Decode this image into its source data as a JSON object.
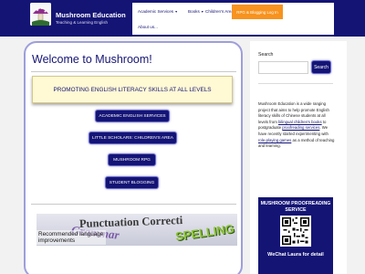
{
  "site": {
    "title": "Mushroom Education",
    "tagline": "Teaching & Learning English"
  },
  "nav": {
    "items": [
      "Academic Services",
      "Books",
      "Children's Area",
      "About us..."
    ],
    "cta": "RPG & Blogging Log In"
  },
  "main": {
    "title": "Welcome to Mushroom!",
    "banner": "PROMOTING ENGLISH LITERACY SKILLS AT ALL LEVELS",
    "buttons": [
      "ACADEMIC ENGLISH SERVICES",
      "LITTLE SCHOLARS: CHILDREN'S AREA",
      "MUSHROOM RPG",
      "STUDENT BLOGGING"
    ],
    "promo": {
      "words": [
        "Punctuation Correcti",
        "Grammar",
        "SPELLING"
      ],
      "note": "Recommended language improvements"
    }
  },
  "sidebar": {
    "search_label": "Search",
    "search_placeholder": "",
    "search_button": "Search",
    "about": {
      "intro": "Mushroom Education is a wide ranging project that aims to help promote English literacy skills of Chinese students at all levels from ",
      "link1": "bilingual children's books",
      "mid1": " to postgraduate ",
      "link2": "proofreading services",
      "mid2": ". We have recently started experimenting with ",
      "link3": "role-playing games",
      "outro": " as a method of teaching and learning."
    },
    "ad": {
      "title": "MUSHROOM PROOFREADING SERVICE",
      "caption": "WeChat Laura for detail"
    }
  },
  "colors": {
    "brand_navy": "#141475",
    "accent_orange": "#f7931e",
    "banner_yellow": "#fff9d4"
  },
  "icons": [
    "mushroom-logo-icon",
    "chevron-down-icon",
    "qr-code-icon"
  ]
}
